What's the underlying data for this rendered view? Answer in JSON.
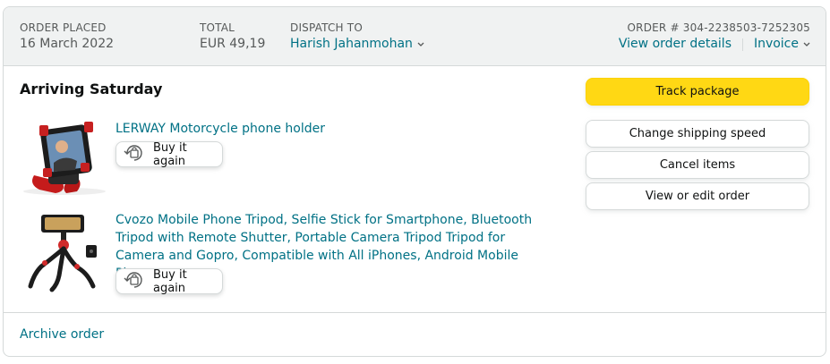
{
  "header": {
    "order_placed_label": "ORDER PLACED",
    "order_placed_value": "16 March 2022",
    "total_label": "TOTAL",
    "total_value": "EUR 49,19",
    "dispatch_label": "DISPATCH TO",
    "dispatch_value": "Harish Jahanmohan",
    "order_number": "ORDER # 304-2238503-7252305",
    "view_details_link": "View order details",
    "invoice_link": "Invoice"
  },
  "shipment": {
    "status": "Arriving Saturday"
  },
  "items": [
    {
      "title": "LERWAY Motorcycle phone holder",
      "buy_again_label": "Buy it again",
      "image_icon": "motorcycle-phone-holder-image"
    },
    {
      "title": "Cvozo Mobile Phone Tripod, Selfie Stick for Smartphone, Bluetooth Tripod with Remote Shutter, Portable Camera Tripod Tripod for Camera and Gopro, Compatible with All iPhones, Android Mobile Phones",
      "buy_again_label": "Buy it again",
      "image_icon": "flexible-tripod-image"
    }
  ],
  "actions": {
    "track_package": "Track package",
    "change_shipping_speed": "Change shipping speed",
    "cancel_items": "Cancel items",
    "view_or_edit_order": "View or edit order"
  },
  "footer": {
    "archive_order": "Archive order"
  },
  "colors": {
    "link": "#007185",
    "primary_button": "#ffd814",
    "header_bg": "#f0f2f2",
    "border": "#d5d9d9"
  }
}
